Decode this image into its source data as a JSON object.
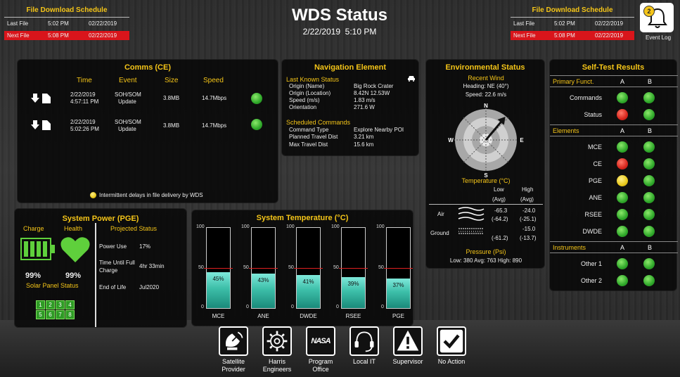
{
  "header": {
    "title": "WDS Status",
    "datetime": "2/22/2019  5:10 PM"
  },
  "schedule_left": {
    "title": "File Download Schedule",
    "rows": [
      {
        "label": "Last File",
        "time": "5:02 PM",
        "date": "02/22/2019"
      },
      {
        "label": "Next File",
        "time": "5:08 PM",
        "date": "02/22/2019"
      }
    ]
  },
  "schedule_right": {
    "title": "File Download Schedule",
    "rows": [
      {
        "label": "Last File",
        "time": "5:02 PM",
        "date": "02/22/2019"
      },
      {
        "label": "Next File",
        "time": "5:08 PM",
        "date": "02/22/2019"
      }
    ]
  },
  "event_log": {
    "label": "Event Log",
    "count": "2"
  },
  "comms": {
    "title": "Comms (CE)",
    "headers": [
      "Time",
      "Event",
      "Size",
      "Speed"
    ],
    "rows": [
      {
        "date": "2/22/2019",
        "time": "4:57:11 PM",
        "event1": "SOH/SOM",
        "event2": "Update",
        "size": "3.8MB",
        "speed": "14.7Mbps"
      },
      {
        "date": "2/22/2019",
        "time": "5:02:26 PM",
        "event1": "SOH/SOM",
        "event2": "Update",
        "size": "3.8MB",
        "speed": "14.7Mbps"
      }
    ],
    "note": "Intermittent delays in file delivery by WDS"
  },
  "navigation": {
    "title": "Navigation Element",
    "last_known": "Last Known Status",
    "rows": [
      {
        "label": "Origin (Name)",
        "value": "Big Rock Crater"
      },
      {
        "label": "Origin (Location)",
        "value": "8.42N 12.53W"
      },
      {
        "label": "Speed (m/s)",
        "value": "1.83 m/s"
      },
      {
        "label": "Orientation",
        "value": "271.6 W"
      }
    ],
    "scheduled": "Scheduled Commands",
    "cmd_rows": [
      {
        "label": "Command Type",
        "value": "Explore Nearby POI"
      },
      {
        "label": "Planned Travel Dist",
        "value": "3.21 km"
      },
      {
        "label": "Max Travel Dist",
        "value": "15.6 km"
      }
    ]
  },
  "environment": {
    "title": "Environmental Status",
    "wind_title": "Recent Wind",
    "heading": "Heading: NE (40°)",
    "speed": "Speed: 22.6 m/s",
    "compass": {
      "n": "N",
      "s": "S",
      "e": "E",
      "w": "W"
    },
    "wind_heading_deg": 40,
    "temp_title": "Temperature (°C)",
    "col_low": "Low",
    "col_high": "High",
    "avg": "(Avg)",
    "air_label": "Air",
    "air_low": "-65.3",
    "air_low_avg": "(-64.2)",
    "air_high": "-24.0",
    "air_high_avg": "(-25.1)",
    "ground_label": "Ground",
    "ground_low_avg": "(-61.2)",
    "ground_high": "-15.0",
    "ground_high_avg": "(-13.7)",
    "pressure_title": "Pressure (Psi)",
    "pressure_values": "Low: 380  Avg: 763  High: 890"
  },
  "selftest": {
    "title": "Self-Test Results",
    "col_a": "A",
    "col_b": "B",
    "sections": [
      {
        "title": "Primary Funct.",
        "rows": [
          {
            "label": "Commands",
            "a": "green",
            "b": "green"
          },
          {
            "label": "Status",
            "a": "red",
            "b": "green"
          }
        ]
      },
      {
        "title": "Elements",
        "rows": [
          {
            "label": "MCE",
            "a": "green",
            "b": "green"
          },
          {
            "label": "CE",
            "a": "red",
            "b": "green"
          },
          {
            "label": "PGE",
            "a": "yellow",
            "b": "green"
          },
          {
            "label": "ANE",
            "a": "green",
            "b": "green"
          },
          {
            "label": "RSEE",
            "a": "green",
            "b": "green"
          },
          {
            "label": "DWDE",
            "a": "green",
            "b": "green"
          }
        ]
      },
      {
        "title": "Instruments",
        "rows": [
          {
            "label": "Other 1",
            "a": "green",
            "b": "green"
          },
          {
            "label": "Other 2",
            "a": "green",
            "b": "green"
          }
        ]
      }
    ]
  },
  "power": {
    "title": "System Power (PGE)",
    "charge_label": "Charge",
    "health_label": "Health",
    "charge_value": "99%",
    "health_value": "99%",
    "solar_title": "Solar Panel Status",
    "solar_panels": [
      "1",
      "2",
      "3",
      "4",
      "5",
      "6",
      "7",
      "8"
    ],
    "projected_title": "Projected Status",
    "rows": [
      {
        "label": "Power Use",
        "value": "17%"
      },
      {
        "label": "Time Until Full Charge",
        "value": "4hr 33min"
      },
      {
        "label": "End of Life",
        "value": "Jul2020"
      }
    ]
  },
  "temperature": {
    "title": "System Temperature (°C)",
    "scale_max": "100",
    "scale_mid": "50",
    "scale_min": "0",
    "threshold": 50,
    "bars": [
      {
        "name": "MCE",
        "value": 45,
        "label": "45%"
      },
      {
        "name": "ANE",
        "value": 43,
        "label": "43%"
      },
      {
        "name": "DWDE",
        "value": 41,
        "label": "41%"
      },
      {
        "name": "RSEE",
        "value": 39,
        "label": "39%"
      },
      {
        "name": "PGE",
        "value": 37,
        "label": "37%"
      }
    ]
  },
  "contacts": [
    {
      "label1": "Satellite",
      "label2": "Provider",
      "icon": "satellite-dish-icon"
    },
    {
      "label1": "Harris",
      "label2": "Engineers",
      "icon": "gear-icon"
    },
    {
      "label1": "Program",
      "label2": "Office",
      "icon": "nasa-logo-icon",
      "logo_text": "NASA"
    },
    {
      "label1": "Local IT",
      "label2": "",
      "icon": "headset-icon"
    },
    {
      "label1": "Supervisor",
      "label2": "",
      "icon": "warning-icon"
    },
    {
      "label1": "No Action",
      "label2": "",
      "icon": "checkmark-icon"
    }
  ]
}
